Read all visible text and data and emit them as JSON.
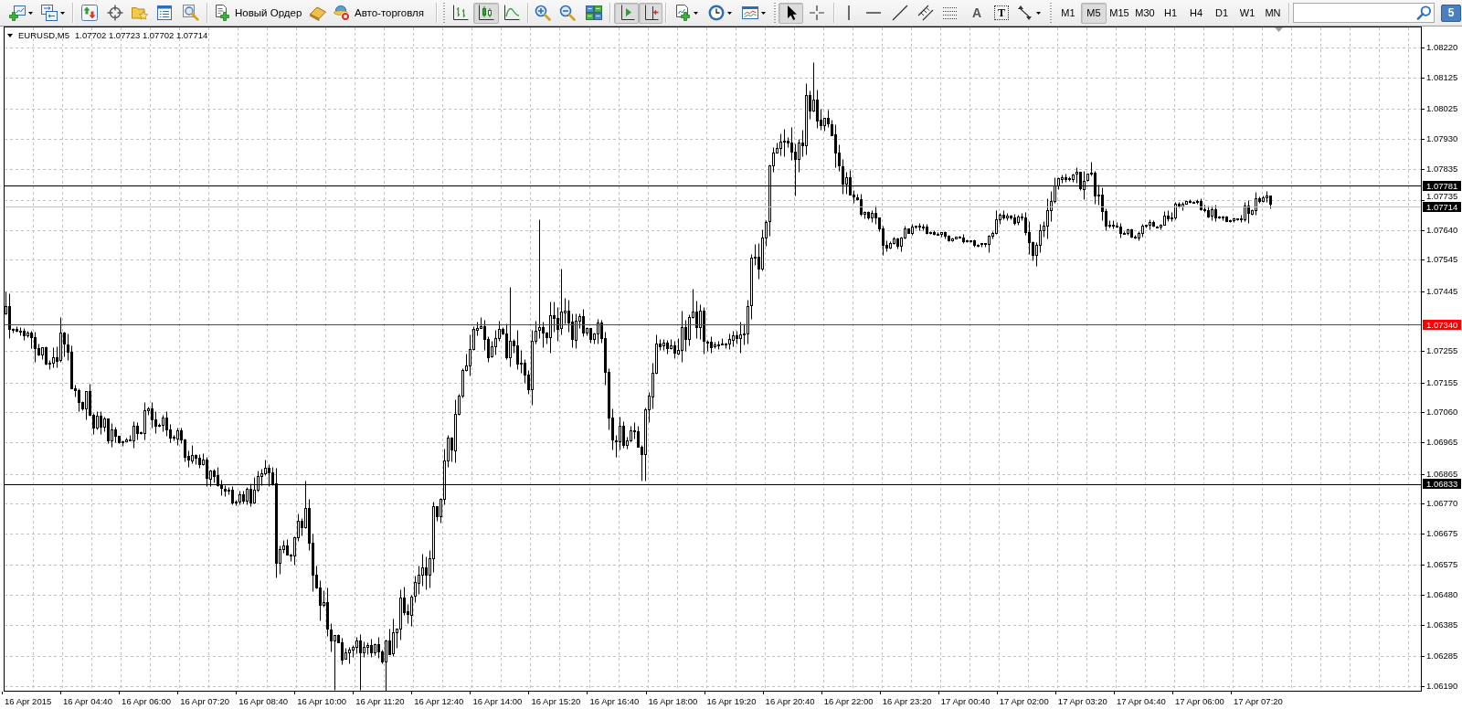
{
  "toolbar": {
    "order_button": {
      "label": "Новый Ордер"
    },
    "autotrading_button": {
      "label": "Авто-торговля",
      "on": false
    },
    "chart_types": [
      {
        "selected": false
      },
      {
        "selected": true
      },
      {
        "selected": false
      }
    ],
    "chart_shift": {
      "on": true
    },
    "autoscroll": {
      "on": true
    },
    "pointer_tools": [
      {
        "selected": true
      },
      {
        "selected": false
      }
    ],
    "text_tools": [
      {
        "label": "A"
      },
      {
        "label": "T"
      }
    ],
    "timeframes": [
      {
        "label": "M1",
        "selected": false
      },
      {
        "label": "M5",
        "selected": true
      },
      {
        "label": "M15",
        "selected": false
      },
      {
        "label": "M30",
        "selected": false
      },
      {
        "label": "H1",
        "selected": false
      },
      {
        "label": "H4",
        "selected": false
      },
      {
        "label": "D1",
        "selected": false
      },
      {
        "label": "W1",
        "selected": false
      },
      {
        "label": "MN",
        "selected": false
      }
    ],
    "message_count": "5"
  },
  "chart": {
    "symbol": "EURUSD,M5",
    "quote": "1.07702 1.07723 1.07702 1.07714",
    "price_ticks": [
      "1.08220",
      "1.08125",
      "1.08025",
      "1.07930",
      "1.07835",
      "1.07735",
      "1.07640",
      "1.07545",
      "1.07445",
      "1.07255",
      "1.07155",
      "1.07060",
      "1.06965",
      "1.06865",
      "1.06770",
      "1.06675",
      "1.06575",
      "1.06480",
      "1.06385",
      "1.06285",
      "1.06190"
    ],
    "price_lines": [
      {
        "label": "1.07781",
        "kind": "level",
        "color": "#000000"
      },
      {
        "label": "1.07714",
        "kind": "bid",
        "color": "#c0c0c0"
      },
      {
        "label": "1.07340",
        "kind": "level",
        "color": "#ff0000"
      },
      {
        "label": "1.06833",
        "kind": "level",
        "color": "#000000"
      }
    ],
    "time_labels": [
      "16 Apr 2015",
      "16 Apr 04:40",
      "16 Apr 06:00",
      "16 Apr 07:20",
      "16 Apr 08:40",
      "16 Apr 10:00",
      "16 Apr 11:20",
      "16 Apr 12:40",
      "16 Apr 14:00",
      "16 Apr 15:20",
      "16 Apr 16:40",
      "16 Apr 18:00",
      "16 Apr 19:20",
      "16 Apr 20:40",
      "16 Apr 22:00",
      "16 Apr 23:20",
      "17 Apr 00:40",
      "17 Apr 02:00",
      "17 Apr 03:20",
      "17 Apr 04:40",
      "17 Apr 06:00",
      "17 Apr 07:20"
    ]
  }
}
